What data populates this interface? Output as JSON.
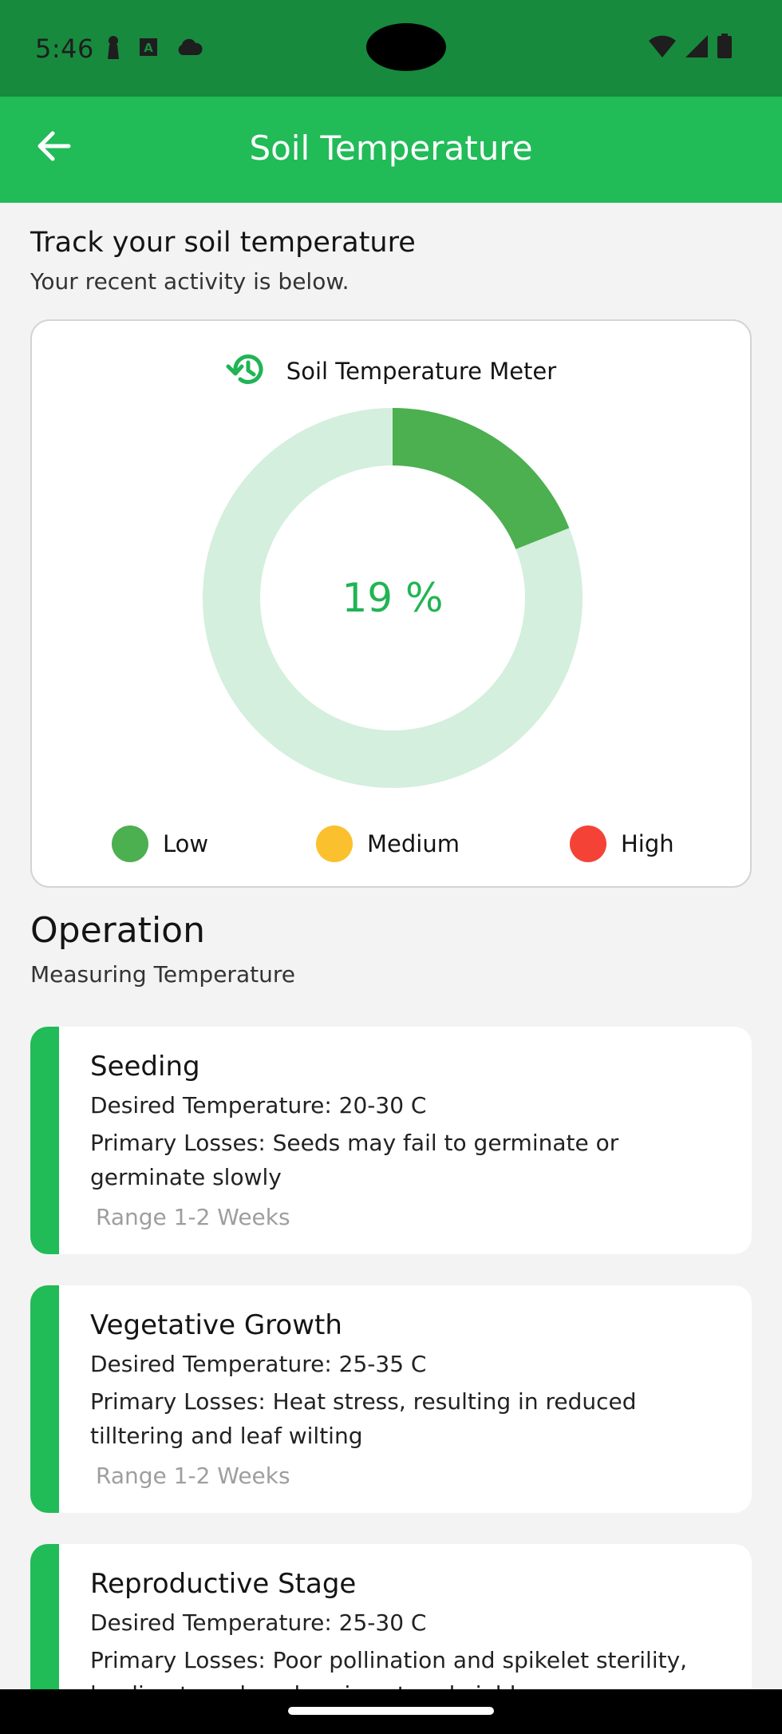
{
  "status_bar": {
    "time": "5:46",
    "left_icons": [
      "keyhole-icon",
      "a-box-icon",
      "cloud-icon"
    ],
    "right_icons": [
      "wifi-icon",
      "signal-icon",
      "battery-icon"
    ]
  },
  "app_bar": {
    "title": "Soil Temperature",
    "back_icon": "arrow-left-icon"
  },
  "header": {
    "heading": "Track your soil temperature",
    "subheading": "Your recent activity is below."
  },
  "meter": {
    "title": "Soil Temperature Meter",
    "icon": "history-icon",
    "value_text": "19 %",
    "value_fraction": 0.19,
    "colors": {
      "fill": "#4caf50",
      "track": "#d4efdd",
      "value_text": "#21b454"
    },
    "legend": [
      {
        "label": "Low",
        "color": "#4caf50"
      },
      {
        "label": "Medium",
        "color": "#fbc02d"
      },
      {
        "label": "High",
        "color": "#f44336"
      }
    ]
  },
  "operation": {
    "heading": "Operation",
    "subheading": "Measuring Temperature",
    "stages": [
      {
        "title": "Seeding",
        "desired": "Desired Temperature: 20-30 C",
        "losses": "Primary Losses: Seeds may fail to germinate or germinate slowly",
        "range": "Range 1-2 Weeks"
      },
      {
        "title": "Vegetative Growth",
        "desired": "Desired Temperature: 25-35 C",
        "losses": "Primary Losses: Heat stress, resulting in reduced tilltering and leaf wilting",
        "range": "Range 1-2 Weeks"
      },
      {
        "title": "Reproductive Stage",
        "desired": "Desired Temperature: 25-30 C",
        "losses": "Primary Losses: Poor pollination and spikelet sterility, leading to reduced grain set and yield",
        "range": ""
      }
    ]
  },
  "theme": {
    "status_bar": "#178a3e",
    "app_bar": "#21bb58",
    "accent": "#21bb58"
  }
}
